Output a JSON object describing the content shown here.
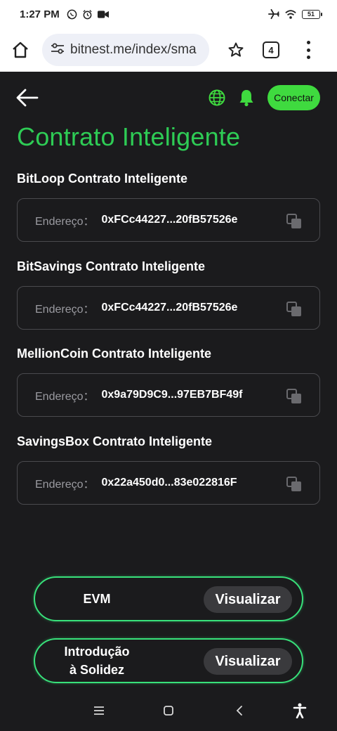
{
  "status_bar": {
    "time": "1:27 PM",
    "battery_level": "51",
    "icons_left": [
      "whatsapp-icon",
      "alarm-icon",
      "video-camera-icon"
    ],
    "icons_right": [
      "airplane-icon",
      "wifi-icon",
      "battery-icon"
    ]
  },
  "browser": {
    "url": "bitnest.me/index/sma",
    "tab_count": "4",
    "icons": [
      "home-icon",
      "site-settings-icon",
      "star-icon",
      "tabs-icon",
      "menu-icon"
    ]
  },
  "header": {
    "connect_label": "Conectar",
    "accent_color": "#3fda3f"
  },
  "page_title": "Contrato Inteligente",
  "contracts": [
    {
      "name": "BitLoop Contrato Inteligente",
      "label": "Endereço：",
      "address": "0xFCc44227...20fB57526e"
    },
    {
      "name": "BitSavings Contrato Inteligente",
      "label": "Endereço：",
      "address": "0xFCc44227...20fB57526e"
    },
    {
      "name": "MellionCoin Contrato Inteligente",
      "label": "Endereço：",
      "address": "0x9a79D9C9...97EB7BF49f"
    },
    {
      "name": "SavingsBox Contrato Inteligente",
      "label": "Endereço：",
      "address": "0x22a450d0...83e022816F"
    }
  ],
  "actions": [
    {
      "label_line1": "EVM",
      "label_line2": "",
      "button": "Visualizar"
    },
    {
      "label_line1": "Introdução",
      "label_line2": "à Solidez",
      "button": "Visualizar"
    }
  ],
  "colors": {
    "title": "#2ecc55",
    "card_border": "#38e07a",
    "background": "#1b1b1d"
  }
}
